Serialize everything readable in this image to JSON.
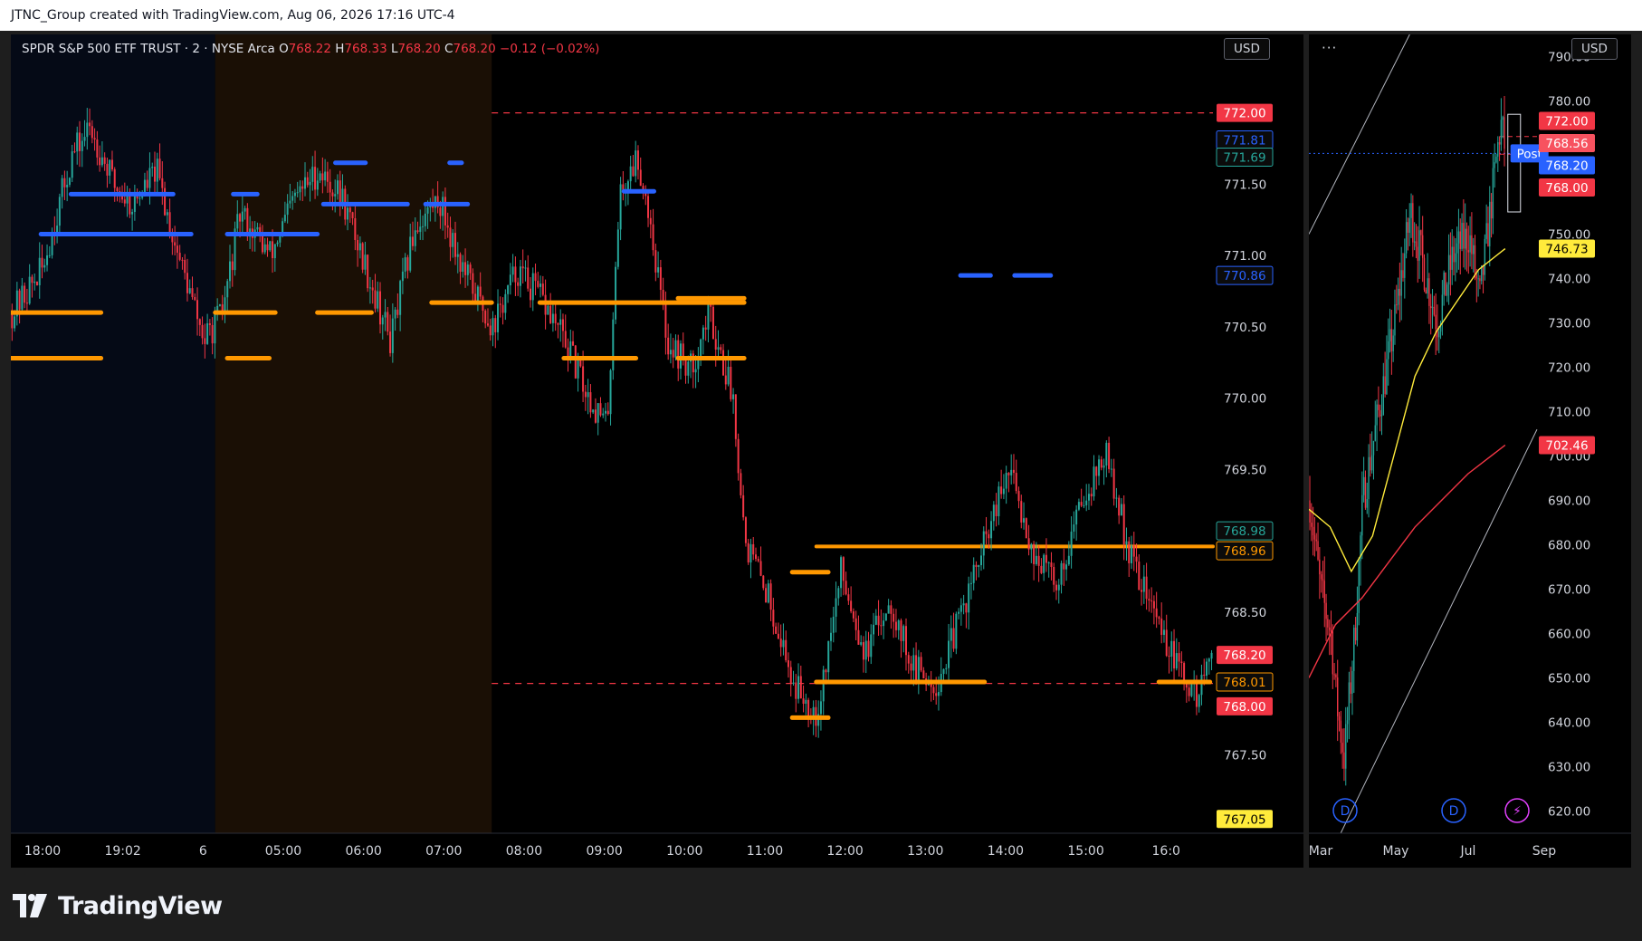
{
  "header": {
    "attribution": "JTNC_Group created with TradingView.com, Aug 06, 2026 17:16 UTC-4"
  },
  "brand": {
    "name": "TradingView"
  },
  "main_chart": {
    "legend": {
      "symbol": "SPDR S&P 500 ETF TRUST · 2 · NYSE Arca",
      "open_label": "O",
      "open": "768.22",
      "high_label": "H",
      "high": "768.33",
      "low_label": "L",
      "low": "768.20",
      "close_label": "C",
      "close": "768.20",
      "change": "−0.12 (−0.02%)"
    },
    "currency": "USD",
    "colors": {
      "up": "#26a69a",
      "down": "#f23645",
      "orange": "#ff9800",
      "blue": "#2962ff",
      "premarket_bg": "#1a0f05",
      "overnight_bg": "#050a16"
    }
  },
  "chart_data": [
    {
      "type": "line",
      "title": "",
      "axis_currency": "USD",
      "x_ticks": [
        "18:00",
        "19:02",
        "6",
        "05:00",
        "06:00",
        "07:00",
        "08:00",
        "09:00",
        "10:00",
        "11:00",
        "12:00",
        "13:00",
        "14:00",
        "15:00",
        "16:0"
      ],
      "y_ticks": [
        "771.50",
        "771.00",
        "770.50",
        "770.00",
        "769.50",
        "768.50",
        "767.50"
      ],
      "ylim": [
        766.95,
        772.55
      ],
      "price_path": [
        {
          "x": 0.0,
          "y": 770.6
        },
        {
          "x": 0.5,
          "y": 770.9
        },
        {
          "x": 1.0,
          "y": 771.7
        },
        {
          "x": 1.3,
          "y": 771.9
        },
        {
          "x": 1.7,
          "y": 771.5
        },
        {
          "x": 2.0,
          "y": 771.35
        },
        {
          "x": 2.4,
          "y": 771.6
        },
        {
          "x": 2.7,
          "y": 771.1
        },
        {
          "x": 3.2,
          "y": 770.4
        },
        {
          "x": 3.5,
          "y": 770.6
        },
        {
          "x": 3.8,
          "y": 771.3
        },
        {
          "x": 4.3,
          "y": 771.0
        },
        {
          "x": 4.7,
          "y": 771.4
        },
        {
          "x": 5.1,
          "y": 771.6
        },
        {
          "x": 5.5,
          "y": 771.4
        },
        {
          "x": 5.9,
          "y": 770.9
        },
        {
          "x": 6.3,
          "y": 770.4
        },
        {
          "x": 6.7,
          "y": 771.2
        },
        {
          "x": 7.1,
          "y": 771.4
        },
        {
          "x": 7.5,
          "y": 770.9
        },
        {
          "x": 8.0,
          "y": 770.5
        },
        {
          "x": 8.4,
          "y": 770.9
        },
        {
          "x": 8.8,
          "y": 770.7
        },
        {
          "x": 9.2,
          "y": 770.4
        },
        {
          "x": 9.6,
          "y": 770.0
        },
        {
          "x": 9.9,
          "y": 769.8
        },
        {
          "x": 10.1,
          "y": 771.4
        },
        {
          "x": 10.4,
          "y": 771.7
        },
        {
          "x": 10.6,
          "y": 771.3
        },
        {
          "x": 10.9,
          "y": 770.4
        },
        {
          "x": 11.3,
          "y": 770.2
        },
        {
          "x": 11.6,
          "y": 770.6
        },
        {
          "x": 12.0,
          "y": 770.0
        },
        {
          "x": 12.2,
          "y": 769.0
        },
        {
          "x": 12.6,
          "y": 768.6
        },
        {
          "x": 13.0,
          "y": 768.0
        },
        {
          "x": 13.4,
          "y": 767.8
        },
        {
          "x": 13.8,
          "y": 768.8
        },
        {
          "x": 14.2,
          "y": 768.2
        },
        {
          "x": 14.6,
          "y": 768.6
        },
        {
          "x": 15.0,
          "y": 768.1
        },
        {
          "x": 15.4,
          "y": 768.0
        },
        {
          "x": 15.8,
          "y": 768.5
        },
        {
          "x": 16.2,
          "y": 769.0
        },
        {
          "x": 16.6,
          "y": 769.5
        },
        {
          "x": 17.0,
          "y": 768.9
        },
        {
          "x": 17.4,
          "y": 768.7
        },
        {
          "x": 17.8,
          "y": 769.3
        },
        {
          "x": 18.2,
          "y": 769.6
        },
        {
          "x": 18.6,
          "y": 768.9
        },
        {
          "x": 19.0,
          "y": 768.5
        },
        {
          "x": 19.4,
          "y": 768.1
        },
        {
          "x": 19.7,
          "y": 767.9
        },
        {
          "x": 19.95,
          "y": 768.2
        }
      ],
      "levels": [
        {
          "name": "dashed-level-high",
          "price": 772.0,
          "color": "#f23645",
          "style": "dashed",
          "x_start": 8.0
        },
        {
          "name": "dashed-level-low",
          "price": 768.0,
          "color": "#f23645",
          "style": "dashed",
          "x_start": 8.0
        },
        {
          "name": "orange-support",
          "price": 768.96,
          "color": "#ff9800",
          "style": "dotted-band",
          "x_start": 13.4
        }
      ],
      "price_labels": [
        {
          "value": "772.00",
          "price": 772.0,
          "bg": "#f23645",
          "fg": "#ffffff",
          "outline": false
        },
        {
          "value": "771.81",
          "price": 771.81,
          "bg": "#0b0b0b",
          "fg": "#2962ff",
          "outline": true
        },
        {
          "value": "771.69",
          "price": 771.69,
          "bg": "#0b0b0b",
          "fg": "#26a69a",
          "outline": true
        },
        {
          "value": "770.86",
          "price": 770.86,
          "bg": "#0b0b0b",
          "fg": "#2962ff",
          "outline": true
        },
        {
          "value": "768.98",
          "price": 769.07,
          "bg": "#0b0b0b",
          "fg": "#26a69a",
          "outline": true
        },
        {
          "value": "768.96",
          "price": 768.93,
          "bg": "#0b0b0b",
          "fg": "#ff9800",
          "outline": true
        },
        {
          "value": "768.20",
          "price": 768.2,
          "bg": "#f23645",
          "fg": "#ffffff",
          "outline": false
        },
        {
          "value": "768.01",
          "price": 768.01,
          "bg": "#0b0b0b",
          "fg": "#ff9800",
          "outline": true
        },
        {
          "value": "768.00",
          "price": 767.84,
          "bg": "#f23645",
          "fg": "#ffffff",
          "outline": false
        },
        {
          "value": "767.05",
          "price": 767.05,
          "bg": "#ffeb3b",
          "fg": "#000000",
          "outline": false
        }
      ]
    },
    {
      "type": "line",
      "title": "",
      "axis_currency": "USD",
      "x_ticks": [
        "Mar",
        "May",
        "Jul",
        "Sep"
      ],
      "y_ticks": [
        "790.00",
        "780.00",
        "750.00",
        "740.00",
        "730.00",
        "720.00",
        "710.00",
        "700.00",
        "690.00",
        "680.00",
        "670.00",
        "660.00",
        "650.00",
        "640.00",
        "630.00",
        "620.00"
      ],
      "ylim": [
        615,
        795
      ],
      "price_path": [
        {
          "x": 0.0,
          "y": 690
        },
        {
          "x": 0.2,
          "y": 670
        },
        {
          "x": 0.4,
          "y": 660
        },
        {
          "x": 0.5,
          "y": 645
        },
        {
          "x": 0.65,
          "y": 632
        },
        {
          "x": 0.85,
          "y": 660
        },
        {
          "x": 1.0,
          "y": 690
        },
        {
          "x": 1.3,
          "y": 710
        },
        {
          "x": 1.6,
          "y": 730
        },
        {
          "x": 1.9,
          "y": 755
        },
        {
          "x": 2.1,
          "y": 745
        },
        {
          "x": 2.4,
          "y": 730
        },
        {
          "x": 2.7,
          "y": 745
        },
        {
          "x": 3.0,
          "y": 750
        },
        {
          "x": 3.2,
          "y": 735
        },
        {
          "x": 3.45,
          "y": 760
        },
        {
          "x": 3.6,
          "y": 775
        },
        {
          "x": 3.7,
          "y": 768
        }
      ],
      "sma_yellow": [
        {
          "x": 0.0,
          "y": 688
        },
        {
          "x": 0.4,
          "y": 684
        },
        {
          "x": 0.8,
          "y": 674
        },
        {
          "x": 1.2,
          "y": 682
        },
        {
          "x": 1.6,
          "y": 700
        },
        {
          "x": 2.0,
          "y": 718
        },
        {
          "x": 2.4,
          "y": 728
        },
        {
          "x": 2.8,
          "y": 735
        },
        {
          "x": 3.2,
          "y": 742
        },
        {
          "x": 3.7,
          "y": 746.73
        }
      ],
      "sma_red": [
        {
          "x": 0.0,
          "y": 650
        },
        {
          "x": 0.5,
          "y": 662
        },
        {
          "x": 1.0,
          "y": 668
        },
        {
          "x": 1.5,
          "y": 676
        },
        {
          "x": 2.0,
          "y": 684
        },
        {
          "x": 2.5,
          "y": 690
        },
        {
          "x": 3.0,
          "y": 696
        },
        {
          "x": 3.7,
          "y": 702.46
        }
      ],
      "price_labels": [
        {
          "value": "772.00",
          "price": 775.5,
          "bg": "#f23645",
          "fg": "#ffffff"
        },
        {
          "value": "768.56",
          "price": 770.5,
          "bg": "#f7525f",
          "fg": "#ffffff"
        },
        {
          "value": "768.20",
          "price": 765.5,
          "bg": "#2962ff",
          "fg": "#ffffff"
        },
        {
          "value": "768.00",
          "price": 760.5,
          "bg": "#f23645",
          "fg": "#ffffff"
        },
        {
          "value": "746.73",
          "price": 746.73,
          "bg": "#ffeb3b",
          "fg": "#000000"
        },
        {
          "value": "702.46",
          "price": 702.46,
          "bg": "#f23645",
          "fg": "#ffffff"
        }
      ],
      "session_tag": "Post",
      "event_markers": [
        "D",
        "D",
        "⚡"
      ]
    }
  ]
}
